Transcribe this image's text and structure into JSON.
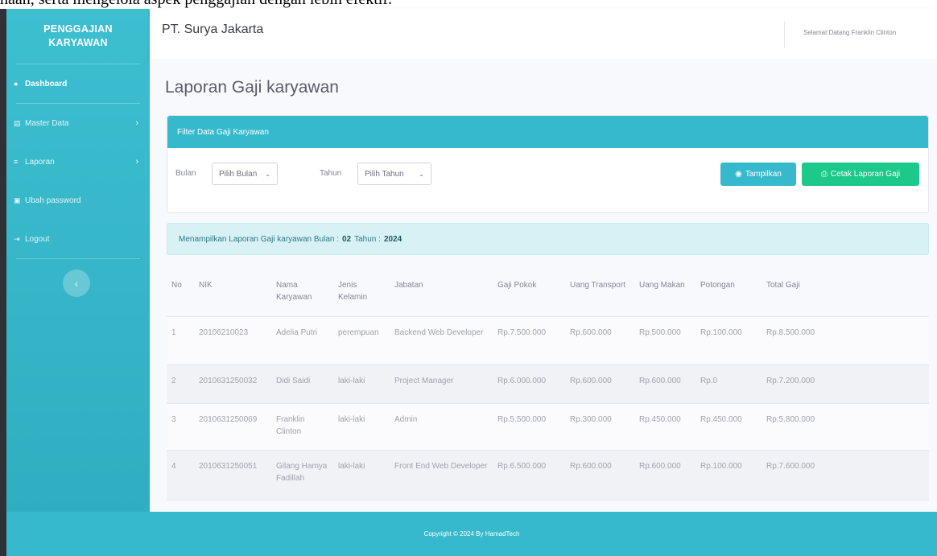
{
  "top_caption": "haan, serta mengelola aspek penggajian dengan lebih efektif.",
  "brand": {
    "line1": "PENGGAJIAN",
    "line2": "KARYAWAN"
  },
  "sidebar": {
    "items": [
      {
        "label": "Dashboard",
        "icon": "tachometer-icon",
        "active": true,
        "has_submenu": false
      },
      {
        "label": "Master Data",
        "icon": "database-icon",
        "active": false,
        "has_submenu": true
      },
      {
        "label": "Laporan",
        "icon": "list-icon",
        "active": false,
        "has_submenu": true
      },
      {
        "label": "Ubah password",
        "icon": "lock-icon",
        "active": false,
        "has_submenu": false
      },
      {
        "label": "Logout",
        "icon": "sign-out-icon",
        "active": false,
        "has_submenu": false
      }
    ],
    "toggle_icon": "chevron-left-icon"
  },
  "topbar": {
    "company": "PT. Surya Jakarta",
    "welcome": "Selamat Datang Franklin Clinton"
  },
  "page_title": "Laporan Gaji karyawan",
  "filter": {
    "header": "Filter Data Gaji Karyawan",
    "bulan_label": "Bulan",
    "bulan_value": "Pilih Bulan",
    "tahun_label": "Tahun",
    "tahun_value": "Pilih Tahun",
    "show_button": "Tampilkan",
    "print_button": "Cetak Laporan Gaji"
  },
  "info": {
    "prefix": "Menampilkan Laporan Gaji karyawan Bulan :",
    "bulan": "02",
    "tahun_label": "Tahun :",
    "tahun": "2024"
  },
  "table": {
    "headers": [
      "No",
      "NIK",
      "Nama Karyawan",
      "Jenis Kelamin",
      "Jabatan",
      "Gaji Pokok",
      "Uang Transport",
      "Uang Makan",
      "Potongan",
      "Total Gaji"
    ],
    "rows": [
      [
        "1",
        "20106210023",
        "Adelia Putri",
        "perempuan",
        "Backend Web Developer",
        "Rp.7.500.000",
        "Rp.600.000",
        "Rp.500.000",
        "Rp.100.000",
        "Rp.8.500.000"
      ],
      [
        "2",
        "2010631250032",
        "Didi Saidi",
        "laki-laki",
        "Project Manager",
        "Rp.6.000.000",
        "Rp.600.000",
        "Rp.600.000",
        "Rp.0",
        "Rp.7.200.000"
      ],
      [
        "3",
        "2010631250069",
        "Franklin Clinton",
        "laki-laki",
        "Admin",
        "Rp.5.500.000",
        "Rp.300.000",
        "Rp.450.000",
        "Rp.450.000",
        "Rp.5.800.000"
      ],
      [
        "4",
        "2010631250051",
        "Gilang Hamya Fadillah",
        "laki-laki",
        "Front End Web Developer",
        "Rp.6.500.000",
        "Rp.600.000",
        "Rp.600.000",
        "Rp.100.000",
        "Rp.7.600.000"
      ]
    ]
  },
  "footer": "Copyright © 2024 By HamadTech",
  "colors": {
    "primary": "#36b9cc",
    "success": "#1cc88a",
    "background": "#f8f9fc"
  }
}
